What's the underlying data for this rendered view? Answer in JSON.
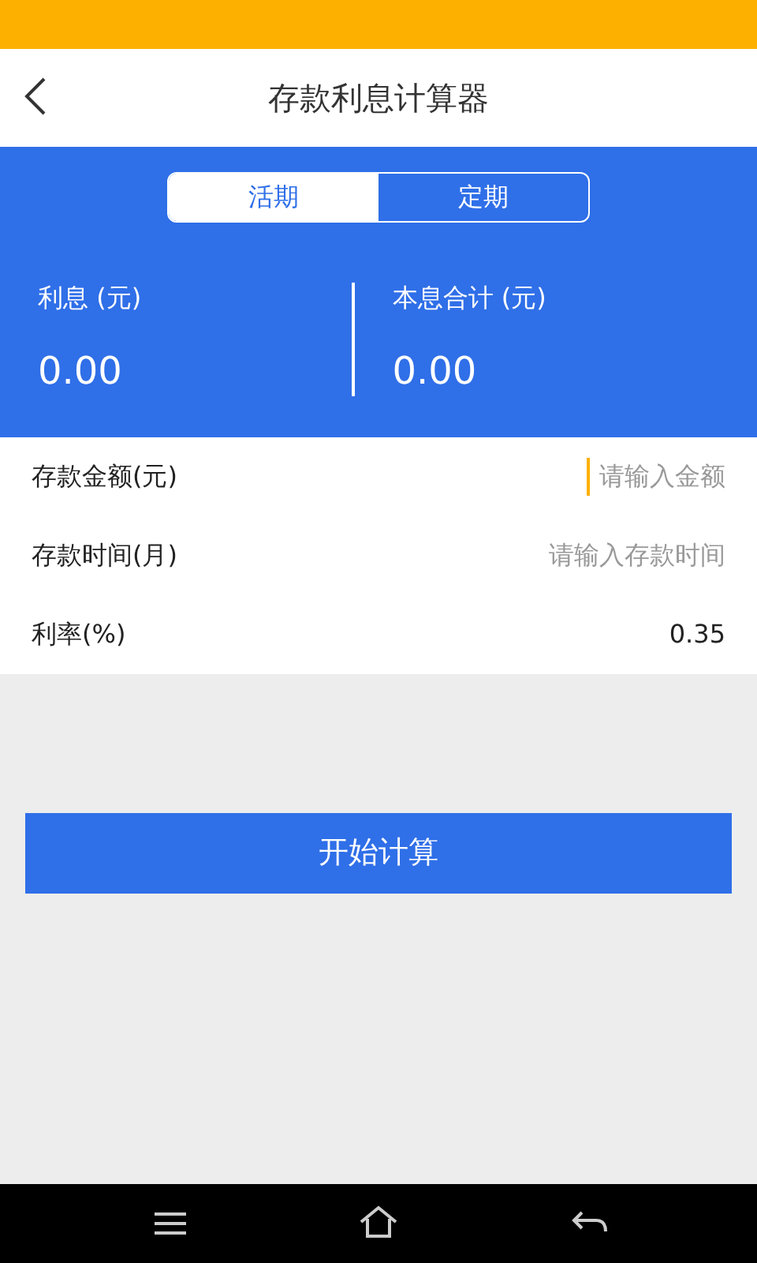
{
  "header": {
    "title": "存款利息计算器"
  },
  "tabs": [
    {
      "label": "活期",
      "selected": true
    },
    {
      "label": "定期",
      "selected": false
    }
  ],
  "results": [
    {
      "label": "利息 (元)",
      "value": "0.00"
    },
    {
      "label": "本息合计 (元)",
      "value": "0.00"
    }
  ],
  "fields": [
    {
      "label": "存款金额(元)",
      "placeholder": "请输入金额",
      "focused": true
    },
    {
      "label": "存款时间(月)",
      "placeholder": "请输入存款时间",
      "focused": false
    },
    {
      "label": "利率(%)",
      "value": "0.35",
      "focused": false
    }
  ],
  "button": {
    "label": "开始计算"
  }
}
